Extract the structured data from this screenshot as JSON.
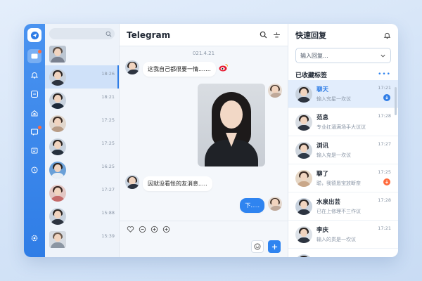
{
  "chat": {
    "title": "Telegram",
    "date": "021.4.21",
    "messages": {
      "m1": "这我自己都很要一情.......",
      "m2": "因就没看怅的友消息.....",
      "m3": "下....."
    }
  },
  "chat_list": {
    "times": [
      "18:26",
      "18:21",
      "17:25",
      "17:25",
      "16:25",
      "17:27",
      "15:88",
      "15:39"
    ]
  },
  "quick_reply": {
    "title": "快速回复",
    "input_value": "输入回复...",
    "section_title": "已收藏标签",
    "items": [
      {
        "name": "聊天",
        "preview": "输入究星一坎议",
        "time": "17:21",
        "badge": "blue"
      },
      {
        "name": "范息",
        "preview": "专业扛湄满场手大议议",
        "time": "17:28",
        "badge": ""
      },
      {
        "name": "浏讯",
        "preview": "输入克是一坎议",
        "time": "17:27",
        "badge": ""
      },
      {
        "name": "聊了",
        "preview": "聪，我德恳宝放断奈",
        "time": "17:25",
        "badge": "orange"
      },
      {
        "name": "水泉出芸",
        "preview": "已在上修理不三作议",
        "time": "17:28",
        "badge": ""
      },
      {
        "name": "李庆",
        "preview": "输入的贯是一坎议",
        "time": "17:21",
        "badge": ""
      },
      {
        "name": "侍庆",
        "preview": "",
        "time": "",
        "badge": ""
      }
    ]
  },
  "colors": {
    "accent": "#2f7de6",
    "badge_orange": "#ff6b3d"
  }
}
